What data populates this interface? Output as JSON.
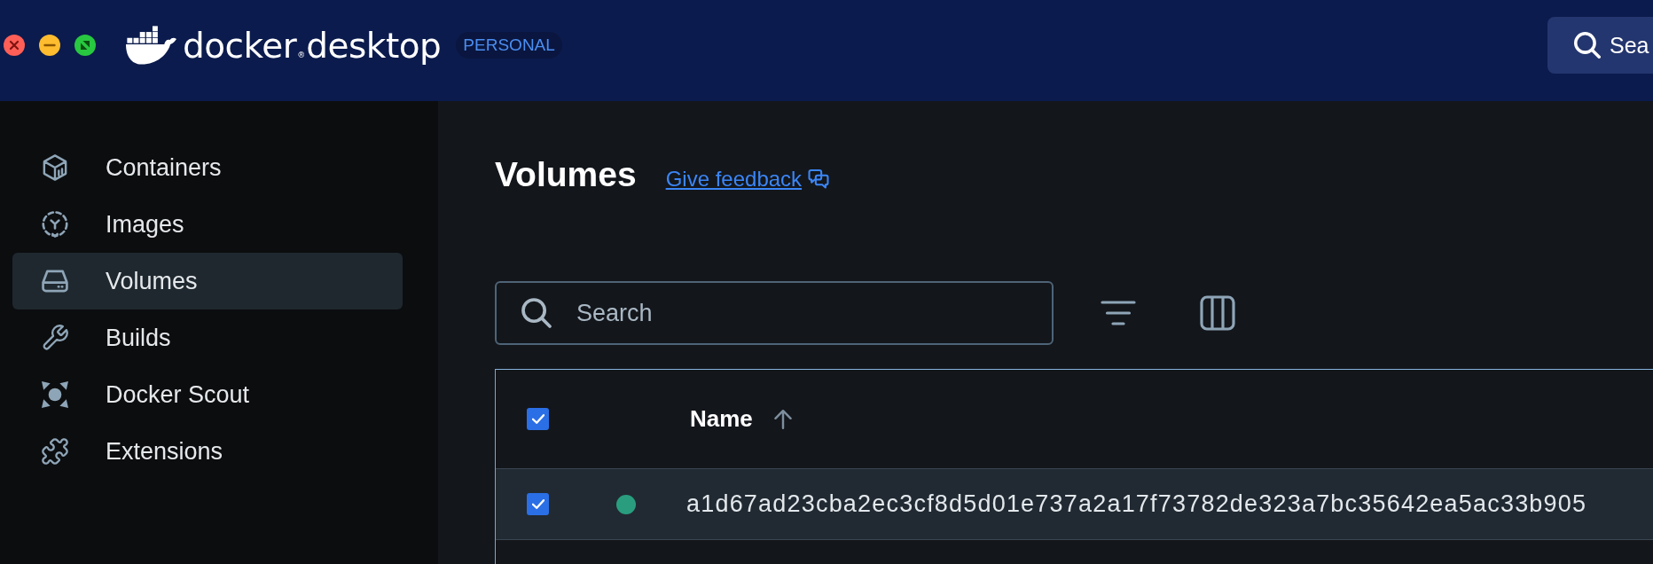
{
  "brand": {
    "name": "docker",
    "mark": "®",
    "product": "desktop",
    "plan": "PERSONAL"
  },
  "top_search": {
    "placeholder": "Sea"
  },
  "sidebar": {
    "items": [
      {
        "label": "Containers",
        "selected": false
      },
      {
        "label": "Images",
        "selected": false
      },
      {
        "label": "Volumes",
        "selected": true
      },
      {
        "label": "Builds",
        "selected": false
      },
      {
        "label": "Docker Scout",
        "selected": false
      },
      {
        "label": "Extensions",
        "selected": false
      }
    ]
  },
  "page": {
    "title": "Volumes",
    "feedback_link": "Give feedback"
  },
  "toolbar": {
    "search": {
      "placeholder": "Search"
    }
  },
  "table": {
    "select_all": {
      "checked": true
    },
    "columns": [
      {
        "label": "Name",
        "sorted": true,
        "sort_ascending": true
      }
    ],
    "rows": [
      {
        "selected": true,
        "checked": true,
        "in_use": true,
        "name": "a1d67ad23cba2ec3cf8d5d01e737a2a17f73782de323a7bc35642ea5ac33b905"
      }
    ]
  }
}
